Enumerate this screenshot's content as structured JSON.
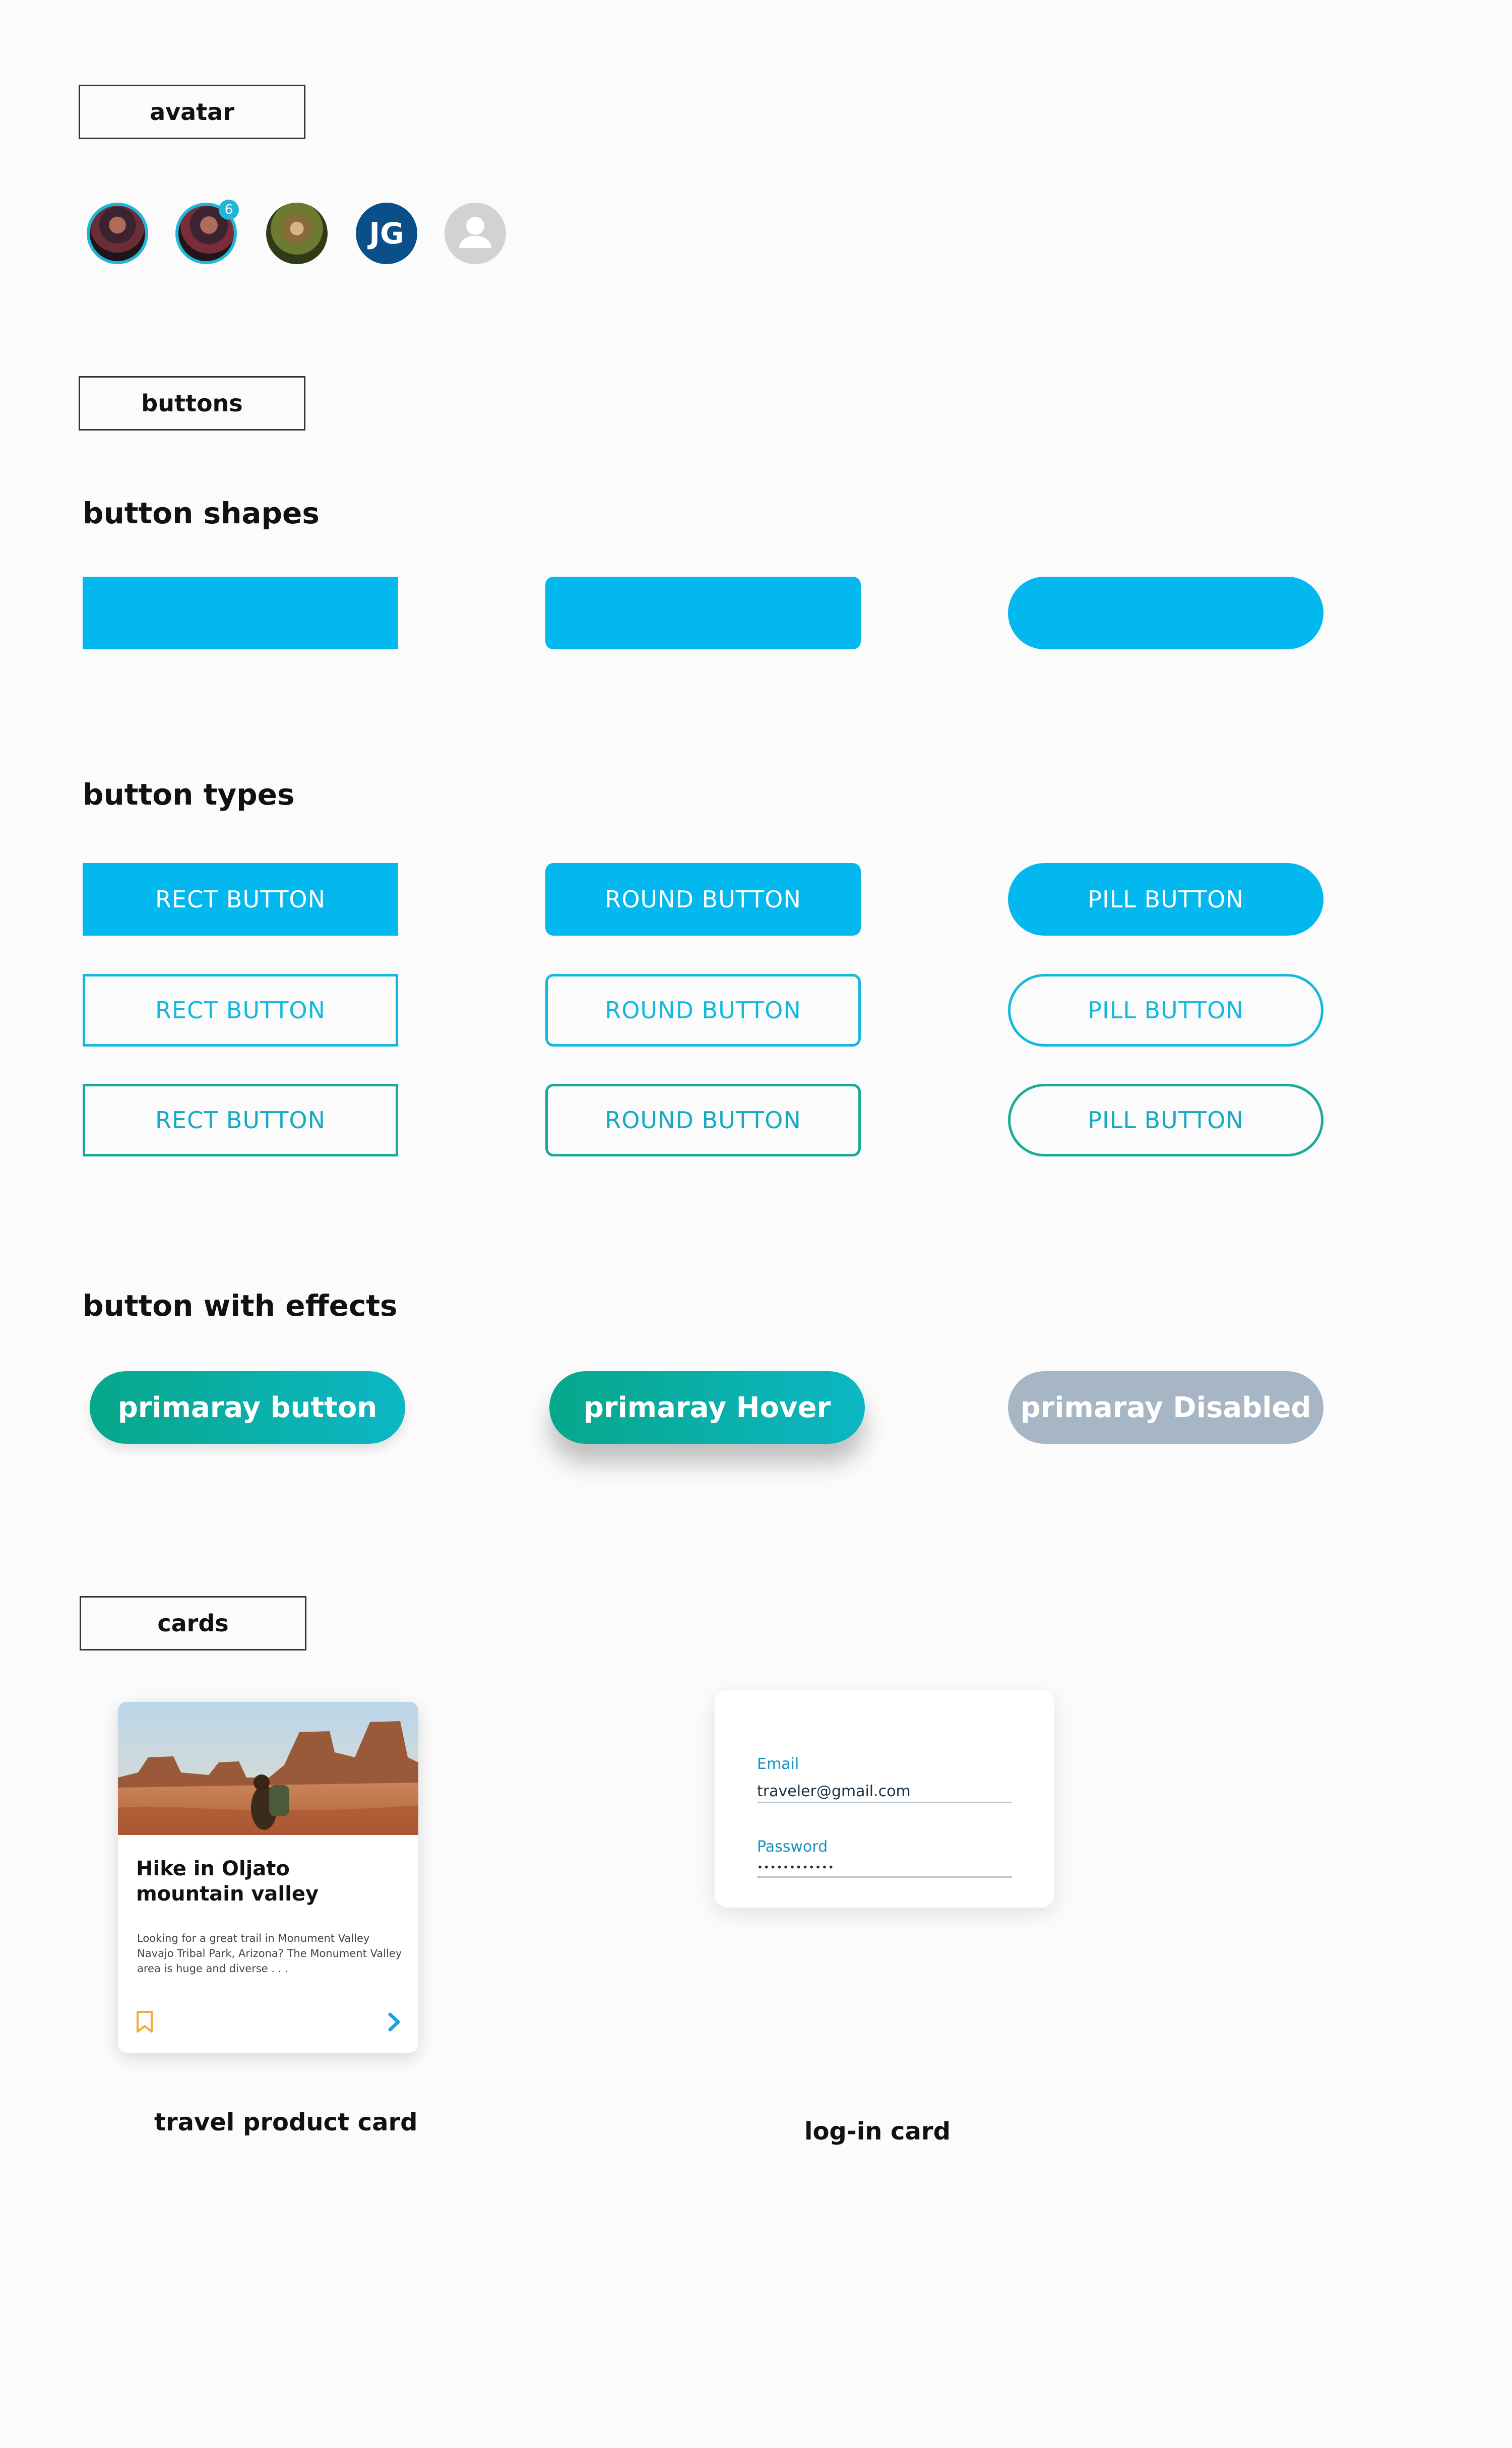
{
  "sections": {
    "avatar": "avatar",
    "buttons": "buttons",
    "cards": "cards"
  },
  "avatars": {
    "badge_count": "6",
    "initials": "JG",
    "accent_color": "#1fb6d8",
    "initials_bg": "#0b4f8a"
  },
  "button_shapes": {
    "heading": "button shapes"
  },
  "button_types": {
    "heading": "button types",
    "rect_label": "RECT BUTTON",
    "round_label": "ROUND BUTTON",
    "pill_label": "PILL BUTTON"
  },
  "button_effects": {
    "heading": "button with effects",
    "primary_label": "primaray button",
    "hover_label": "primaray Hover",
    "disabled_label": "primaray Disabled"
  },
  "colors": {
    "primary": "#02b8ee",
    "teal": "#1aaa97",
    "gradient_start": "#07a78a",
    "gradient_end": "#0db7c5",
    "disabled": "#a6b6c4",
    "bookmark": "#f2a93b"
  },
  "travel_card": {
    "title": "Hike in Oljato mountain valley",
    "description": "Looking for a great trail in Monument Valley Navajo Tribal Park, Arizona? The Monument Valley area is huge and diverse . . .",
    "caption": "travel product card",
    "bookmark_icon": "bookmark-icon",
    "arrow_icon": "chevron-right-icon"
  },
  "login_card": {
    "email_label": "Email",
    "email_value": "traveler@gmail.com",
    "password_label": "Password",
    "password_value": "••••••••••••",
    "caption": "log-in card"
  }
}
